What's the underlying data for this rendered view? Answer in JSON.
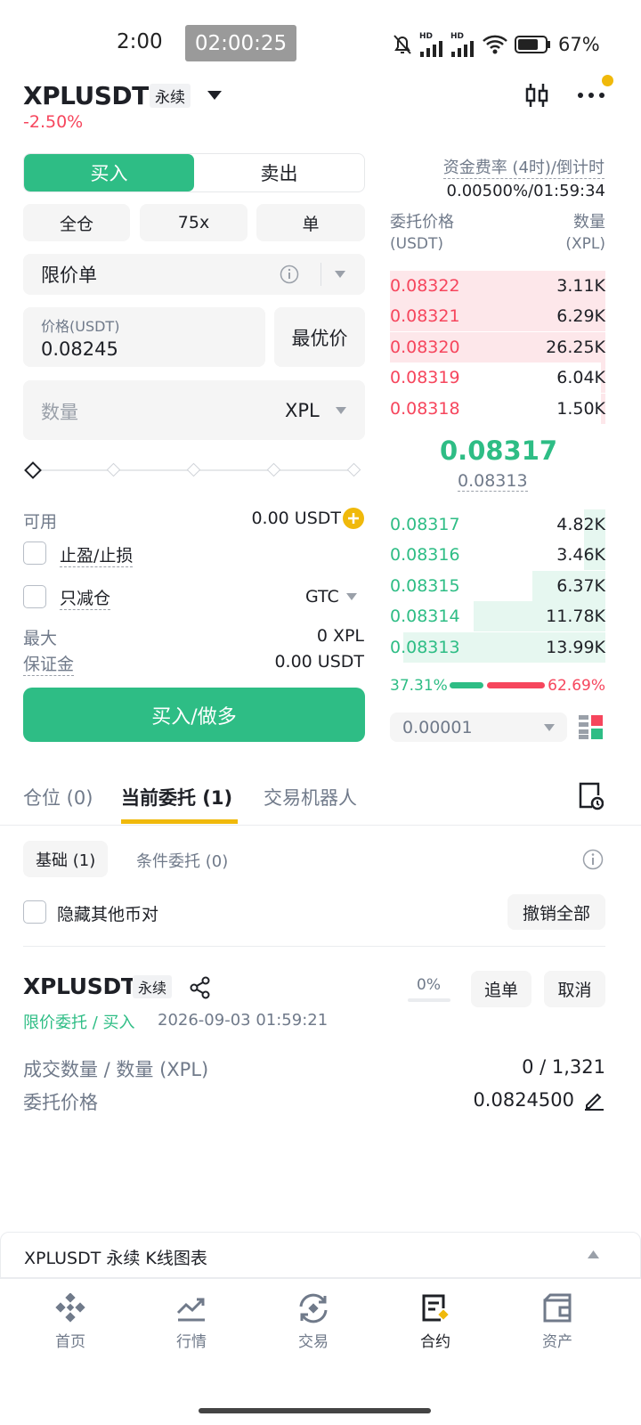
{
  "status_bar": {
    "time": "2:00",
    "timer": "02:00:25",
    "battery": "67%",
    "net1": "HD",
    "net2": "HD"
  },
  "header": {
    "pair": "XPLUSDT",
    "contract_type": "永续",
    "change": "-2.50%"
  },
  "order_form": {
    "buy_label": "买入",
    "sell_label": "卖出",
    "margin_mode": "全仓",
    "leverage": "75x",
    "position_mode": "单",
    "order_type": "限价单",
    "price_label": "价格(USDT)",
    "price_value": "0.08245",
    "best_price": "最优价",
    "qty_placeholder": "数量",
    "qty_unit": "XPL",
    "available_label": "可用",
    "available_value": "0.00 USDT",
    "tpsl_label": "止盈/止损",
    "reduce_only_label": "只减仓",
    "tif": "GTC",
    "max_label": "最大",
    "max_value": "0 XPL",
    "margin_label": "保证金",
    "margin_value": "0.00 USDT",
    "submit": "买入/做多",
    "slider_level": 0
  },
  "order_book": {
    "funding_label": "资金费率 (4时)/倒计时",
    "funding_value": "0.00500%/01:59:34",
    "price_header": "委托价格",
    "price_unit": "(USDT)",
    "qty_header": "数量",
    "qty_unit": "(XPL)",
    "asks": [
      {
        "price": "0.08322",
        "qty": "3.11K",
        "depth": 1.0
      },
      {
        "price": "0.08321",
        "qty": "6.29K",
        "depth": 1.0
      },
      {
        "price": "0.08320",
        "qty": "26.25K",
        "depth": 1.0
      },
      {
        "price": "0.08319",
        "qty": "6.04K",
        "depth": 0.02
      },
      {
        "price": "0.08318",
        "qty": "1.50K",
        "depth": 0.02
      }
    ],
    "last_price": "0.08317",
    "mark_price": "0.08313",
    "bids": [
      {
        "price": "0.08317",
        "qty": "4.82K",
        "depth": 0.1
      },
      {
        "price": "0.08316",
        "qty": "3.46K",
        "depth": 0.1
      },
      {
        "price": "0.08315",
        "qty": "6.37K",
        "depth": 0.34
      },
      {
        "price": "0.08314",
        "qty": "11.78K",
        "depth": 0.61
      },
      {
        "price": "0.08313",
        "qty": "13.99K",
        "depth": 0.94
      }
    ],
    "buy_ratio": "37.31%",
    "sell_ratio": "62.69%",
    "buy_ratio_value": 37.31,
    "precision": "0.00001"
  },
  "tabs": {
    "positions": "仓位 (0)",
    "open_orders": "当前委托 (1)",
    "bots": "交易机器人"
  },
  "filters": {
    "basic": "基础 (1)",
    "conditional": "条件委托 (0)",
    "hide_others": "隐藏其他币对",
    "cancel_all": "撤销全部"
  },
  "order": {
    "pair": "XPLUSDT",
    "contract_type": "永续",
    "type_side": "限价委托 / 买入",
    "datetime": "2026-09-03 01:59:21",
    "fill_pct": "0%",
    "chase_button": "追单",
    "cancel_button": "取消",
    "filled_label": "成交数量 / 数量 (XPL)",
    "filled_value": "0 / 1,321",
    "price_label": "委托价格",
    "price_value": "0.0824500"
  },
  "kline_bar": {
    "label": "XPLUSDT 永续 K线图表"
  },
  "nav": [
    {
      "label": "首页",
      "icon": "home-icon"
    },
    {
      "label": "行情",
      "icon": "market-icon"
    },
    {
      "label": "交易",
      "icon": "trade-icon"
    },
    {
      "label": "合约",
      "icon": "futures-icon"
    },
    {
      "label": "资产",
      "icon": "wallet-icon"
    }
  ],
  "colors": {
    "green": "#2ebd85",
    "red": "#f6465d",
    "yellow": "#f0b90b"
  }
}
